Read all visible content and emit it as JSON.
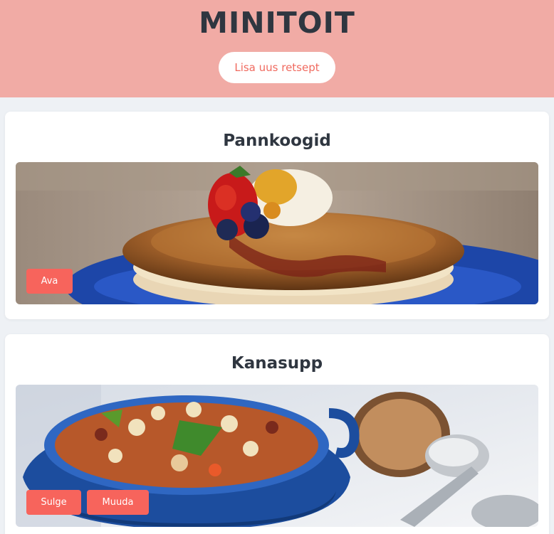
{
  "header": {
    "title": "MINITOIT",
    "add_button_label": "Lisa uus retsept"
  },
  "recipes": [
    {
      "title": "Pannkoogid",
      "image": "pancakes-with-strawberry-photo",
      "actions": [
        "Ava"
      ]
    },
    {
      "title": "Kanasupp",
      "image": "chicken-soup-pot-photo",
      "actions": [
        "Sulge",
        "Muuda"
      ]
    }
  ],
  "colors": {
    "header_bg": "#f1aba5",
    "accent": "#f7645c",
    "title_text": "#2f3640",
    "page_bg": "#eef1f5"
  }
}
